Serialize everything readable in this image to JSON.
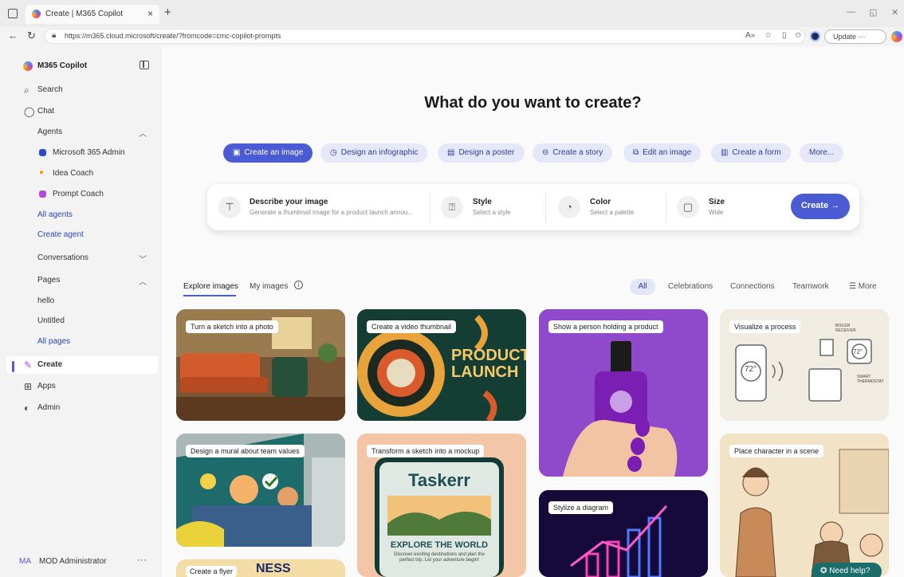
{
  "browser": {
    "tab_title": "Create | M365 Copilot",
    "url": "https://m365.cloud.microsoft/create/?fromcode=cmc-copilot-prompts",
    "update_label": "Update ···"
  },
  "sidebar": {
    "brand": "M365 Copilot",
    "search": "Search",
    "chat": "Chat",
    "agents_header": "Agents",
    "agents": [
      {
        "label": "Microsoft 365 Admin",
        "color": "#2b4acb"
      },
      {
        "label": "Idea Coach",
        "color": "#f0a21a"
      },
      {
        "label": "Prompt Coach",
        "color": "#b14ad8"
      }
    ],
    "all_agents": "All agents",
    "create_agent": "Create agent",
    "conversations": "Conversations",
    "pages_header": "Pages",
    "pages": [
      "hello",
      "Untitled"
    ],
    "all_pages": "All pages",
    "create": "Create",
    "apps": "Apps",
    "admin": "Admin",
    "user_initials": "MA",
    "user_name": "MOD Administrator"
  },
  "main": {
    "headline": "What do you want to create?",
    "pills": [
      {
        "label": "Create an image",
        "icon": "image-icon"
      },
      {
        "label": "Design an infographic",
        "icon": "infographic-icon"
      },
      {
        "label": "Design a poster",
        "icon": "poster-icon"
      },
      {
        "label": "Create a story",
        "icon": "story-icon"
      },
      {
        "label": "Edit an image",
        "icon": "edit-image-icon"
      },
      {
        "label": "Create a form",
        "icon": "form-icon"
      },
      {
        "label": "More...",
        "icon": ""
      }
    ],
    "prompt": {
      "describe_title": "Describe your image",
      "describe_sub": "Generate a thumbnail image for a product launch annou...",
      "style_title": "Style",
      "style_sub": "Select a style",
      "color_title": "Color",
      "color_sub": "Select a palette",
      "size_title": "Size",
      "size_sub": "Wide",
      "create_label": "Create →"
    },
    "tabs": {
      "explore": "Explore images",
      "my": "My images"
    },
    "filters": {
      "all": "All",
      "items": [
        "Celebrations",
        "Connections",
        "Teamwork"
      ],
      "more": "More"
    },
    "cards": [
      "Turn a sketch into a photo",
      "Create a video thumbnail",
      "Show a person holding a product",
      "Visualize a process",
      "Design a mural about team values",
      "Transform a sketch into a mockup",
      "Stylize a diagram",
      "Place character in a scene",
      "Create a flyer"
    ],
    "card_art": {
      "product_launch_line1": "PRODUCT",
      "product_launch_line2": "LAUNCH",
      "taskerr_title": "Taskerr",
      "taskerr_headline": "EXPLORE THE WORLD",
      "taskerr_body": "Discover exciting destinations and plan the perfect trip. Let your adventure begin!",
      "process_temp": "72°",
      "process_label1": "BOILER RECEIVER",
      "process_label2": "SMART THERMOSTAT",
      "flyer_text": "NESS"
    },
    "help_label": "Need help?"
  }
}
